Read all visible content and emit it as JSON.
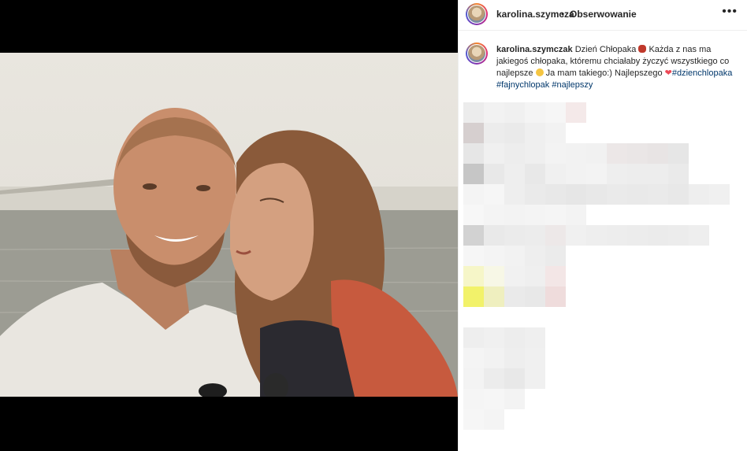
{
  "header": {
    "username": "karolina.szymcza",
    "separator": "•",
    "follow_label": "Obserwowanie",
    "more_icon": "more-options-icon"
  },
  "caption": {
    "username": "karolina.szymczak",
    "text_1": "Dzień Chłopaka",
    "text_2": "Każda z nas ma jakiegoś chłopaka, któremu chciałaby życzyć wszystkiego co najlepsze",
    "text_3": "Ja mam takiego:) Najlepszego",
    "hashtag_1": "#dzienchlopaka",
    "hashtag_2": "#fajnychlopak",
    "hashtag_3": "#najlepszy"
  },
  "colors": {
    "tag": "#00376b",
    "heart": "#ed4956",
    "divider": "#efefef"
  }
}
